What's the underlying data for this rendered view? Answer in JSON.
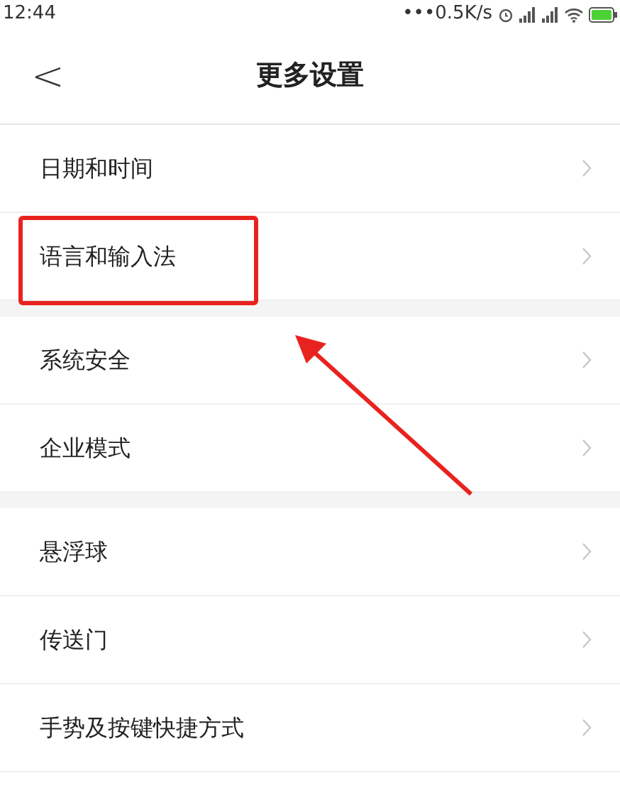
{
  "status_bar": {
    "time": "12:44",
    "speed": "•••0.5K/s"
  },
  "header": {
    "back": "<",
    "title": "更多设置"
  },
  "sections": [
    {
      "items": [
        {
          "label": "日期和时间",
          "highlighted": false
        },
        {
          "label": "语言和输入法",
          "highlighted": true
        }
      ]
    },
    {
      "items": [
        {
          "label": "系统安全",
          "highlighted": false
        },
        {
          "label": "企业模式",
          "highlighted": false
        }
      ]
    },
    {
      "items": [
        {
          "label": "悬浮球",
          "highlighted": false
        },
        {
          "label": "传送门",
          "highlighted": false
        },
        {
          "label": "手势及按键快捷方式",
          "highlighted": false
        }
      ]
    }
  ]
}
